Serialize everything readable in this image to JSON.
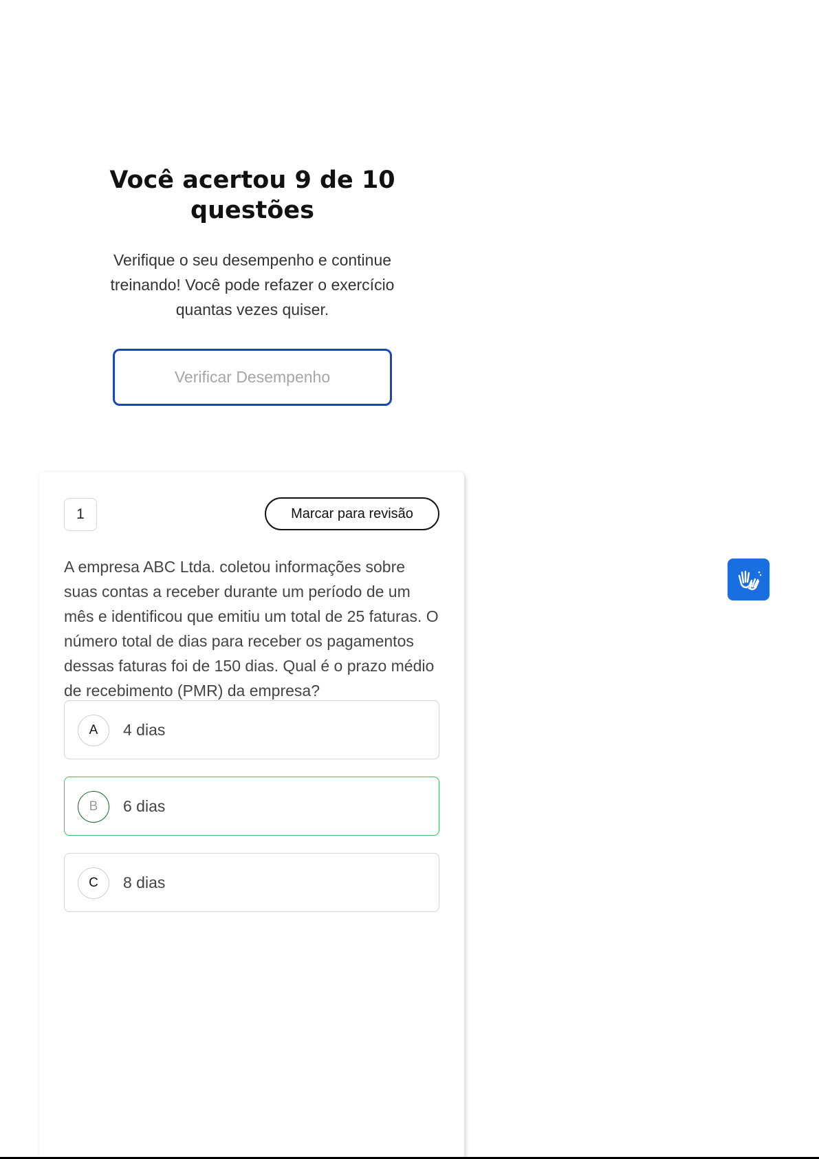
{
  "result": {
    "title": "Você acertou 9 de 10 questões",
    "subtitle": "Verifique o seu desempenho e continue treinando! Você pode refazer o exercício quantas vezes quiser.",
    "button_label": "Verificar Desempenho"
  },
  "question": {
    "number": "1",
    "mark_label": "Marcar para revisão",
    "text": "A empresa ABC Ltda. coletou informações sobre suas contas a receber durante um período de um mês e identificou que emitiu um total de 25 faturas. O número total de dias para receber os pagamentos dessas faturas foi de 150 dias. Qual é o prazo médio de recebimento (PMR) da empresa?",
    "options": [
      {
        "letter": "A",
        "text": "4 dias",
        "state": "default"
      },
      {
        "letter": "B",
        "text": "6 dias",
        "state": "correct"
      },
      {
        "letter": "C",
        "text": "8 dias",
        "state": "default"
      }
    ]
  },
  "accessibility": {
    "icon": "sign-language-hands-icon"
  },
  "colors": {
    "accent_blue": "#1a47b8",
    "correct_green": "#3cbf5c",
    "libras_blue": "#1a6fe0"
  }
}
